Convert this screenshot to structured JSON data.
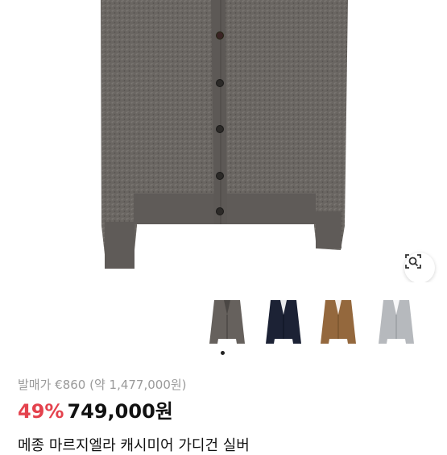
{
  "product": {
    "original_price_text": "발매가 €860 (약 1,477,000원)",
    "discount": "49%",
    "price": "749,000원",
    "title": "메종 마르지엘라 캐시미어 가디건 실버"
  },
  "gallery": {
    "thumbnail_colors": [
      "#66615d",
      "#1c2235",
      "#94683d",
      "#b6b9bd"
    ],
    "active_index": 0,
    "icons": [
      "lens-icon",
      "cardigan-image"
    ]
  }
}
